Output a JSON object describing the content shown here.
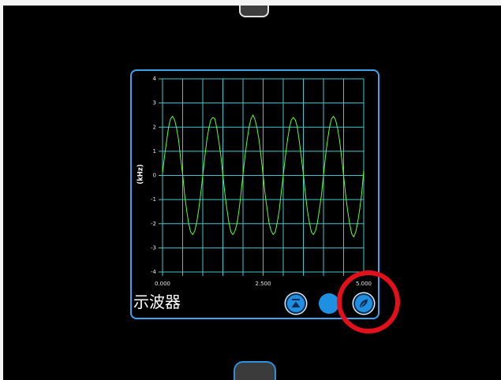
{
  "panel": {
    "title": "示波器"
  },
  "controls": {
    "buttons": [
      {
        "icon": "to-top-icon"
      },
      {
        "icon": "none"
      },
      {
        "icon": "leaf-icon"
      }
    ]
  },
  "colors": {
    "panel_border": "#39a6ec",
    "grid": "#3fc8cc",
    "trace": "#5dff2f",
    "button": "#1f8fe2",
    "annotation": "#e3101b"
  },
  "chart_data": {
    "type": "line",
    "ylabel": "(kHz)",
    "xlim": [
      0,
      5
    ],
    "ylim": [
      -4,
      4
    ],
    "x_tick_labels": [
      "0.000",
      "2.500",
      "5.000"
    ],
    "y_tick_labels": [
      "4",
      "3",
      "2",
      "1",
      "0",
      "-1",
      "-2",
      "-3",
      "-4"
    ],
    "grid": true,
    "legend": "none",
    "series": [
      {
        "color": "#5dff2f",
        "x": [
          0,
          0.05,
          0.1,
          0.15,
          0.2,
          0.25,
          0.3,
          0.35,
          0.4,
          0.45,
          0.5,
          0.55,
          0.6,
          0.65,
          0.7,
          0.75,
          0.8,
          0.85,
          0.9,
          0.95,
          1,
          1.05,
          1.1,
          1.15,
          1.2,
          1.25,
          1.3,
          1.35,
          1.4,
          1.45,
          1.5,
          1.55,
          1.6,
          1.65,
          1.7,
          1.75,
          1.8,
          1.85,
          1.9,
          1.95,
          2,
          2.05,
          2.1,
          2.15,
          2.2,
          2.25,
          2.3,
          2.35,
          2.4,
          2.45,
          2.5,
          2.55,
          2.6,
          2.65,
          2.7,
          2.75,
          2.8,
          2.85,
          2.9,
          2.95,
          3,
          3.05,
          3.1,
          3.15,
          3.2,
          3.25,
          3.3,
          3.35,
          3.4,
          3.45,
          3.5,
          3.55,
          3.6,
          3.65,
          3.7,
          3.75,
          3.8,
          3.85,
          3.9,
          3.95,
          4,
          4.05,
          4.1,
          4.15,
          4.2,
          4.25,
          4.3,
          4.35,
          4.4,
          4.45,
          4.5,
          4.55,
          4.6,
          4.65,
          4.7,
          4.75,
          4.8,
          4.85,
          4.9,
          4.95,
          5
        ],
        "y": [
          0.1,
          0.8,
          1.4,
          2.0,
          2.35,
          2.45,
          2.3,
          1.95,
          1.45,
          0.7,
          0.05,
          -0.8,
          -1.45,
          -2.0,
          -2.35,
          -2.45,
          -2.3,
          -1.95,
          -1.4,
          -0.75,
          0.0,
          0.75,
          1.45,
          1.95,
          2.3,
          2.4,
          2.35,
          1.95,
          1.4,
          0.8,
          0.0,
          -0.75,
          -1.4,
          -1.95,
          -2.35,
          -2.45,
          -2.3,
          -2.0,
          -1.45,
          -0.75,
          0.05,
          0.8,
          1.45,
          2.0,
          2.35,
          2.5,
          2.3,
          1.95,
          1.45,
          0.75,
          0.0,
          -0.8,
          -1.4,
          -2.0,
          -2.3,
          -2.45,
          -2.35,
          -1.95,
          -1.45,
          -0.7,
          0.0,
          0.75,
          1.4,
          1.95,
          2.3,
          2.4,
          2.3,
          2.0,
          1.4,
          0.75,
          0.05,
          -0.75,
          -1.45,
          -1.95,
          -2.35,
          -2.45,
          -2.3,
          -1.95,
          -1.4,
          -0.8,
          0.0,
          0.8,
          1.45,
          2.0,
          2.35,
          2.45,
          2.3,
          1.95,
          1.45,
          0.75,
          0.0,
          -0.8,
          -1.45,
          -2.0,
          -2.4,
          -2.55,
          -2.35,
          -1.95,
          -1.4,
          -0.75,
          0.2
        ]
      }
    ]
  }
}
